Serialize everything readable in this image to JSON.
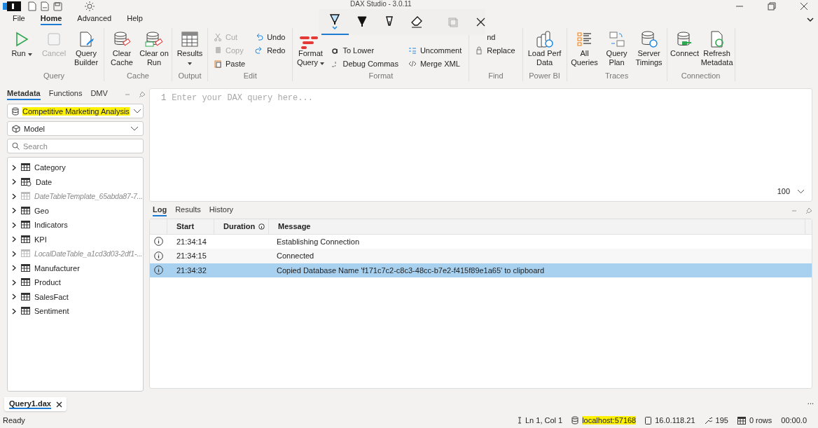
{
  "window": {
    "title": "DAX Studio - 3.0.11"
  },
  "menu_tabs": [
    {
      "label": "File",
      "selected": false
    },
    {
      "label": "Home",
      "selected": true
    },
    {
      "label": "Advanced",
      "selected": false
    },
    {
      "label": "Help",
      "selected": false
    }
  ],
  "ribbon_groups": [
    {
      "label": "Query",
      "large": [
        {
          "label": "Run",
          "dropdown": true,
          "disabled": false
        },
        {
          "label": "Cancel",
          "dropdown": false,
          "disabled": true
        },
        {
          "label": "Query Builder",
          "dropdown": false,
          "disabled": false
        }
      ]
    },
    {
      "label": "Cache",
      "large": [
        {
          "label": "Clear Cache",
          "dropdown": false,
          "disabled": false
        },
        {
          "label": "Clear on Run",
          "dropdown": false,
          "disabled": false
        }
      ]
    },
    {
      "label": "Output",
      "large": [
        {
          "label": "Results",
          "dropdown": true,
          "disabled": false
        }
      ]
    },
    {
      "label": "Edit",
      "small_columns": [
        [
          {
            "label": "Cut",
            "disabled": true
          },
          {
            "label": "Copy",
            "disabled": true
          },
          {
            "label": "Paste",
            "disabled": false
          }
        ],
        [
          {
            "label": "Undo",
            "disabled": false
          },
          {
            "label": "Redo",
            "disabled": false
          }
        ]
      ]
    },
    {
      "label": "Format",
      "large": [
        {
          "label": "Format Query",
          "dropdown": true,
          "disabled": false
        }
      ],
      "small_columns": [
        [
          {
            "label": "To Lower",
            "disabled": false
          },
          {
            "label": "Debug Commas",
            "disabled": false
          }
        ],
        [
          {
            "label": "Uncomment",
            "disabled": false
          },
          {
            "label": "Merge XML",
            "disabled": false
          }
        ]
      ]
    },
    {
      "label": "Find",
      "small_columns": [
        [
          {
            "label": "nd",
            "disabled": false
          },
          {
            "label": "Replace",
            "disabled": false
          }
        ]
      ]
    },
    {
      "label": "Power BI",
      "large": [
        {
          "label": "Load Perf Data",
          "dropdown": false,
          "disabled": false
        }
      ]
    },
    {
      "label": "Traces",
      "large": [
        {
          "label": "All Queries",
          "dropdown": false,
          "disabled": false
        },
        {
          "label": "Query Plan",
          "dropdown": false,
          "disabled": false
        },
        {
          "label": "Server Timings",
          "dropdown": false,
          "disabled": false
        }
      ]
    },
    {
      "label": "Connection",
      "large": [
        {
          "label": "Connect",
          "dropdown": false,
          "disabled": false
        },
        {
          "label": "Refresh Metadata",
          "dropdown": false,
          "disabled": false
        }
      ]
    }
  ],
  "ink_toolbar": {
    "tools": [
      {
        "selected": true
      },
      {
        "selected": false
      },
      {
        "selected": false
      },
      {
        "selected": false
      }
    ]
  },
  "metadata_panel": {
    "tabs": [
      {
        "label": "Metadata",
        "selected": true
      },
      {
        "label": "Functions",
        "selected": false
      },
      {
        "label": "DMV",
        "selected": false
      }
    ],
    "database": {
      "value": "Competitive Marketing Analysis",
      "highlighted": true
    },
    "model": {
      "value": "Model"
    },
    "search": {
      "placeholder": "Search"
    },
    "tables": [
      {
        "name": "Category",
        "hidden": false,
        "kind": "table",
        "expanded": false
      },
      {
        "name": "Date",
        "hidden": false,
        "kind": "date",
        "expanded": false
      },
      {
        "name": "DateTableTemplate_65abda87-7...",
        "hidden": true,
        "kind": "table",
        "expanded": false
      },
      {
        "name": "Geo",
        "hidden": false,
        "kind": "table",
        "expanded": false
      },
      {
        "name": "Indicators",
        "hidden": false,
        "kind": "table",
        "expanded": false
      },
      {
        "name": "KPI",
        "hidden": false,
        "kind": "table",
        "expanded": false
      },
      {
        "name": "LocalDateTable_a1cd3d03-2df1-...",
        "hidden": true,
        "kind": "table",
        "expanded": false
      },
      {
        "name": "Manufacturer",
        "hidden": false,
        "kind": "table",
        "expanded": false
      },
      {
        "name": "Product",
        "hidden": false,
        "kind": "table",
        "expanded": false
      },
      {
        "name": "SalesFact",
        "hidden": false,
        "kind": "table",
        "expanded": false
      },
      {
        "name": "Sentiment",
        "hidden": false,
        "kind": "table",
        "expanded": false
      }
    ]
  },
  "editor": {
    "line_number": "1",
    "placeholder": "Enter your DAX query here...",
    "zoom": "100"
  },
  "output_panel": {
    "tabs": [
      {
        "label": "Log",
        "selected": true
      },
      {
        "label": "Results",
        "selected": false
      },
      {
        "label": "History",
        "selected": false
      }
    ],
    "columns": [
      "Start",
      "Duration",
      "Message"
    ],
    "rows": [
      {
        "start": "21:34:14",
        "message": "Establishing Connection",
        "selected": false
      },
      {
        "start": "21:34:15",
        "message": "Connected",
        "selected": false
      },
      {
        "start": "21:34:32",
        "message": "Copied Database Name 'f171c7c2-c8c3-48cc-b7e2-f415f89e1a65' to clipboard",
        "selected": true
      }
    ]
  },
  "document_tabs": [
    {
      "label": "Query1.dax",
      "selected": true
    }
  ],
  "overflow": "...",
  "status_bar": {
    "state": "Ready",
    "position": "Ln 1, Col 1",
    "server": "localhost:57168",
    "server_highlighted": true,
    "version": "16.0.118.21",
    "spid": "195",
    "rows": "0 rows",
    "duration": "00:00.0"
  }
}
